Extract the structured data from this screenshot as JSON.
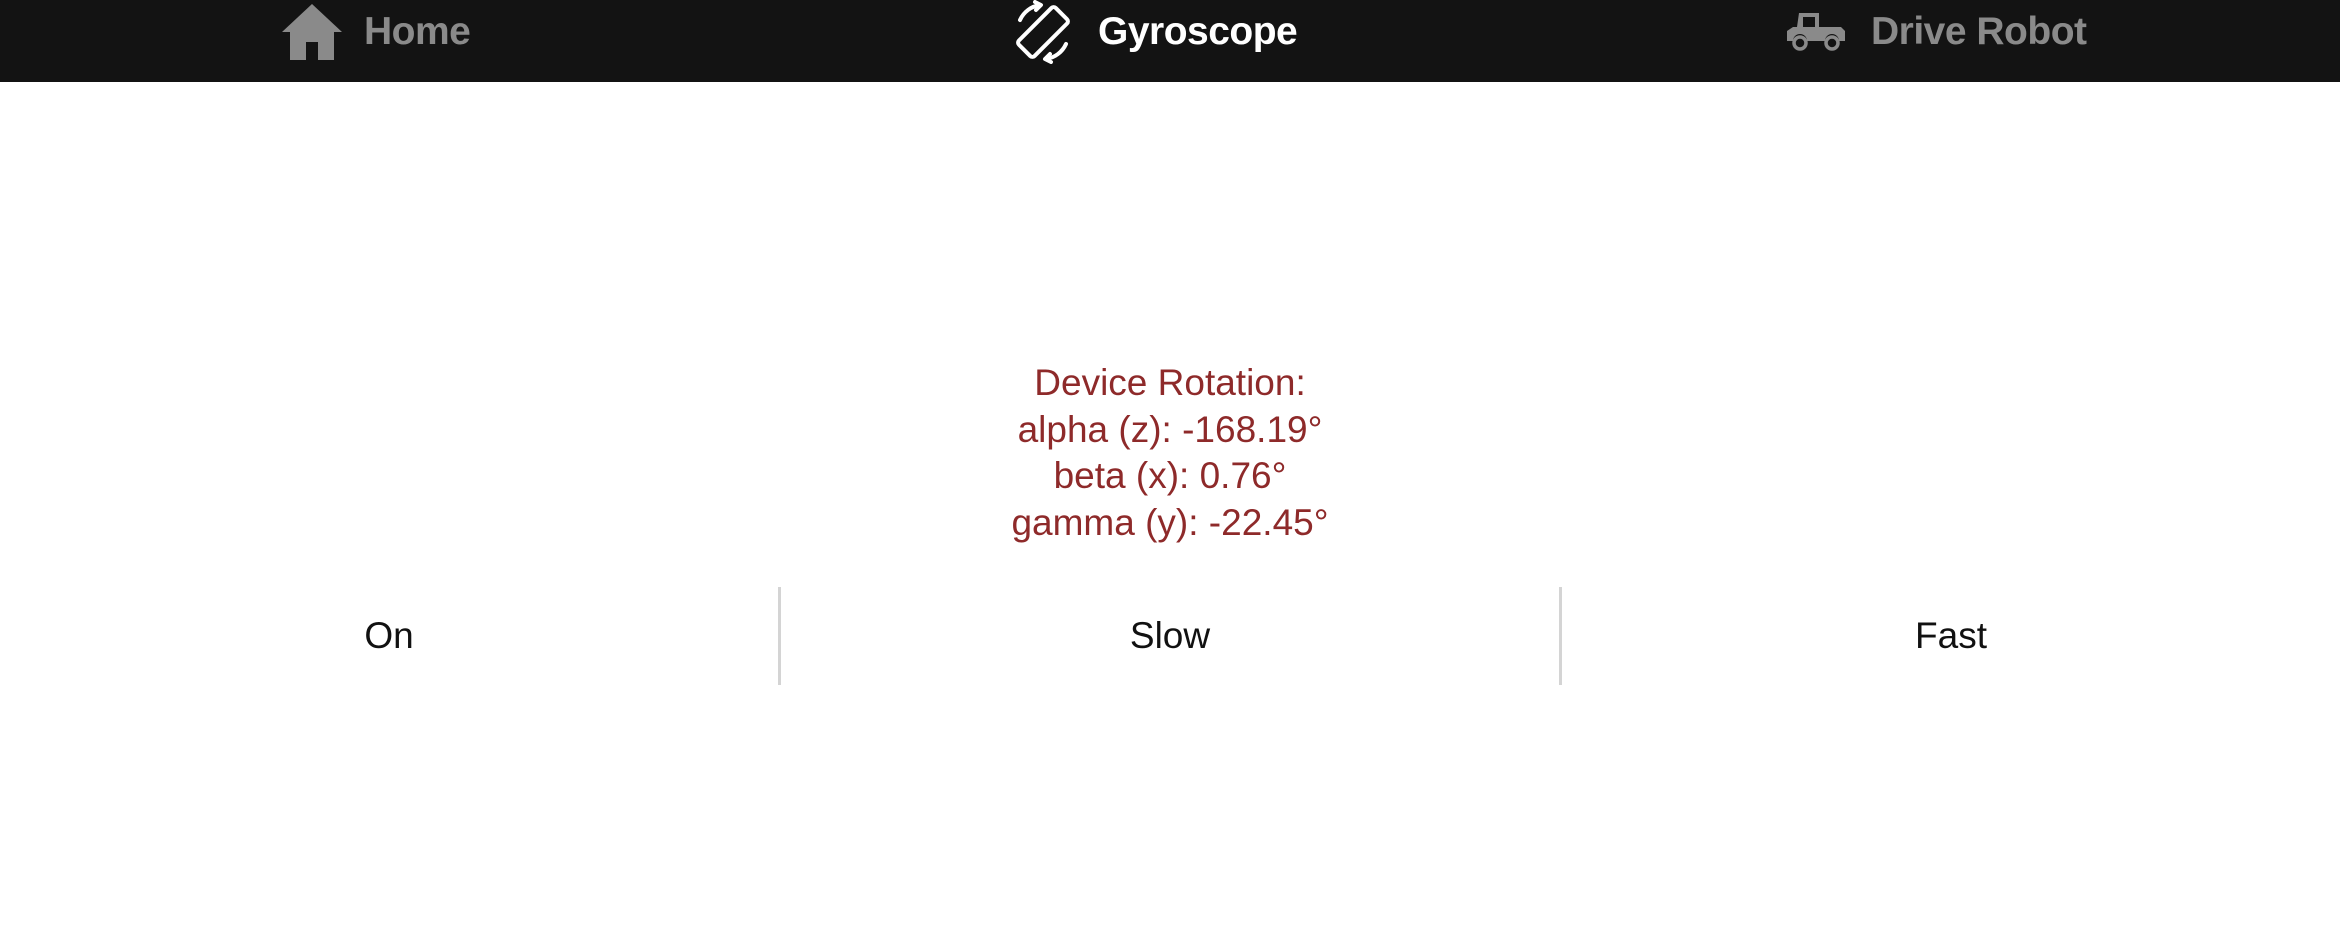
{
  "nav": {
    "items": [
      {
        "label": "Home",
        "icon": "home-icon",
        "active": false
      },
      {
        "label": "Gyroscope",
        "icon": "screen-rotation-icon",
        "active": true
      },
      {
        "label": "Drive Robot",
        "icon": "pickup-truck-icon",
        "active": false
      }
    ]
  },
  "rotation": {
    "heading": "Device Rotation:",
    "alpha": "alpha (z): -168.19°",
    "beta": "beta (x): 0.76°",
    "gamma": "gamma (y): -22.45°"
  },
  "controls": {
    "buttons": [
      "On",
      "Slow",
      "Fast"
    ]
  },
  "colors": {
    "navbar_bg": "#131313",
    "nav_inactive": "#8a8a8a",
    "nav_active": "#ffffff",
    "rotation_text": "#8e2a2a",
    "divider": "#d4d4d4"
  }
}
